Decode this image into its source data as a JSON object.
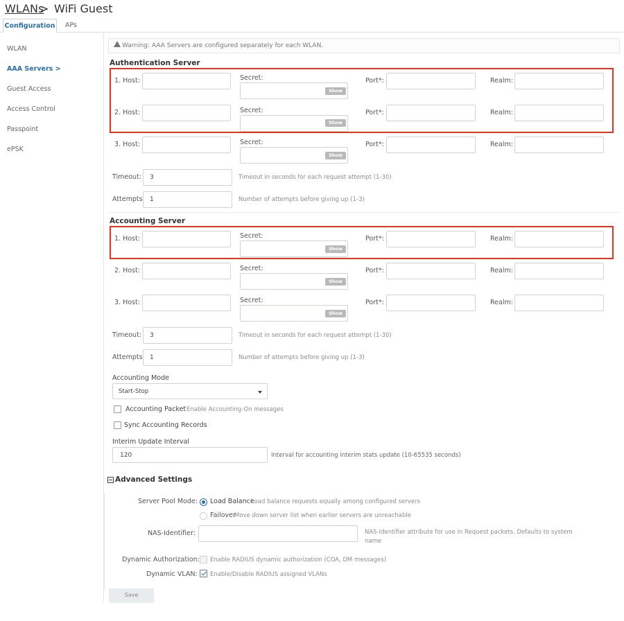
{
  "breadcrumb": {
    "parent": "WLANs",
    "separator": ">",
    "current": "WiFi Guest"
  },
  "tabs": [
    {
      "label": "Configuration"
    },
    {
      "label": "APs"
    }
  ],
  "sidebar": {
    "items": [
      {
        "label": "WLAN"
      },
      {
        "label": "AAA Servers >"
      },
      {
        "label": "Guest Access"
      },
      {
        "label": "Access Control"
      },
      {
        "label": "Passpoint"
      },
      {
        "label": "ePSK"
      }
    ]
  },
  "warning": {
    "text": "Warning: AAA Servers are configured separately for each WLAN."
  },
  "auth": {
    "title": "Authentication Server",
    "rows": [
      {
        "host_label": "1. Host:",
        "secret_label": "Secret:",
        "port_label": "Port*:",
        "realm_label": "Realm:",
        "show_label": "Show"
      },
      {
        "host_label": "2. Host:",
        "secret_label": "Secret:",
        "port_label": "Port*:",
        "realm_label": "Realm:",
        "show_label": "Show"
      },
      {
        "host_label": "3. Host:",
        "secret_label": "Secret:",
        "port_label": "Port*:",
        "realm_label": "Realm:",
        "show_label": "Show"
      }
    ],
    "timeout_label": "Timeout:",
    "timeout_value": "3",
    "timeout_hint": "Timeout in seconds for each request attempt (1-30)",
    "attempts_label": "Attempts:",
    "attempts_value": "1",
    "attempts_hint": "Number of attempts before giving up (1-3)"
  },
  "acct": {
    "title": "Accounting Server",
    "rows": [
      {
        "host_label": "1. Host:",
        "secret_label": "Secret:",
        "port_label": "Port*:",
        "realm_label": "Realm:",
        "show_label": "Show"
      },
      {
        "host_label": "2. Host:",
        "secret_label": "Secret:",
        "port_label": "Port*:",
        "realm_label": "Realm:",
        "show_label": "Show"
      },
      {
        "host_label": "3. Host:",
        "secret_label": "Secret:",
        "port_label": "Port*:",
        "realm_label": "Realm:",
        "show_label": "Show"
      }
    ],
    "timeout_label": "Timeout:",
    "timeout_value": "3",
    "timeout_hint": "Timeout in seconds for each request attempt (1-30)",
    "attempts_label": "Attempts:",
    "attempts_value": "1",
    "attempts_hint": "Number of attempts before giving up (1-3)"
  },
  "accounting_mode": {
    "label": "Accounting Mode",
    "selected": "Start-Stop"
  },
  "accounting_packet": {
    "label": "Accounting Packet",
    "hint": "Enable Accounting-On messages",
    "checked": false
  },
  "sync_records": {
    "label": "Sync Accounting Records",
    "checked": false
  },
  "interim": {
    "label": "Interim Update Interval",
    "value": "120",
    "hint": "Interval for accounting interim stats update (10-65535 seconds)"
  },
  "advanced": {
    "title": "Advanced Settings",
    "server_pool_label": "Server Pool Mode:",
    "load_balance_label": "Load Balance",
    "load_balance_hint": "Load balance requests equally among configured servers",
    "failover_label": "Failover",
    "failover_hint": "Move down server list when earlier servers are unreachable",
    "nas_label": "NAS-Identifier:",
    "nas_hint_line1": "NAS-Identifier attribute for use in Request packets. Defaults to system",
    "nas_hint_line2": "name",
    "dyn_auth_label": "Dynamic Authorization:",
    "dyn_auth_hint": "Enable RADIUS dynamic authorization (COA, DM messages)",
    "dyn_vlan_label": "Dynamic VLAN:",
    "dyn_vlan_hint": "Enable/Disable RADIUS assigned VLANs"
  },
  "save_label": "Save",
  "colors": {
    "accent": "#2d6fa6",
    "highlight": "#e8341c"
  }
}
